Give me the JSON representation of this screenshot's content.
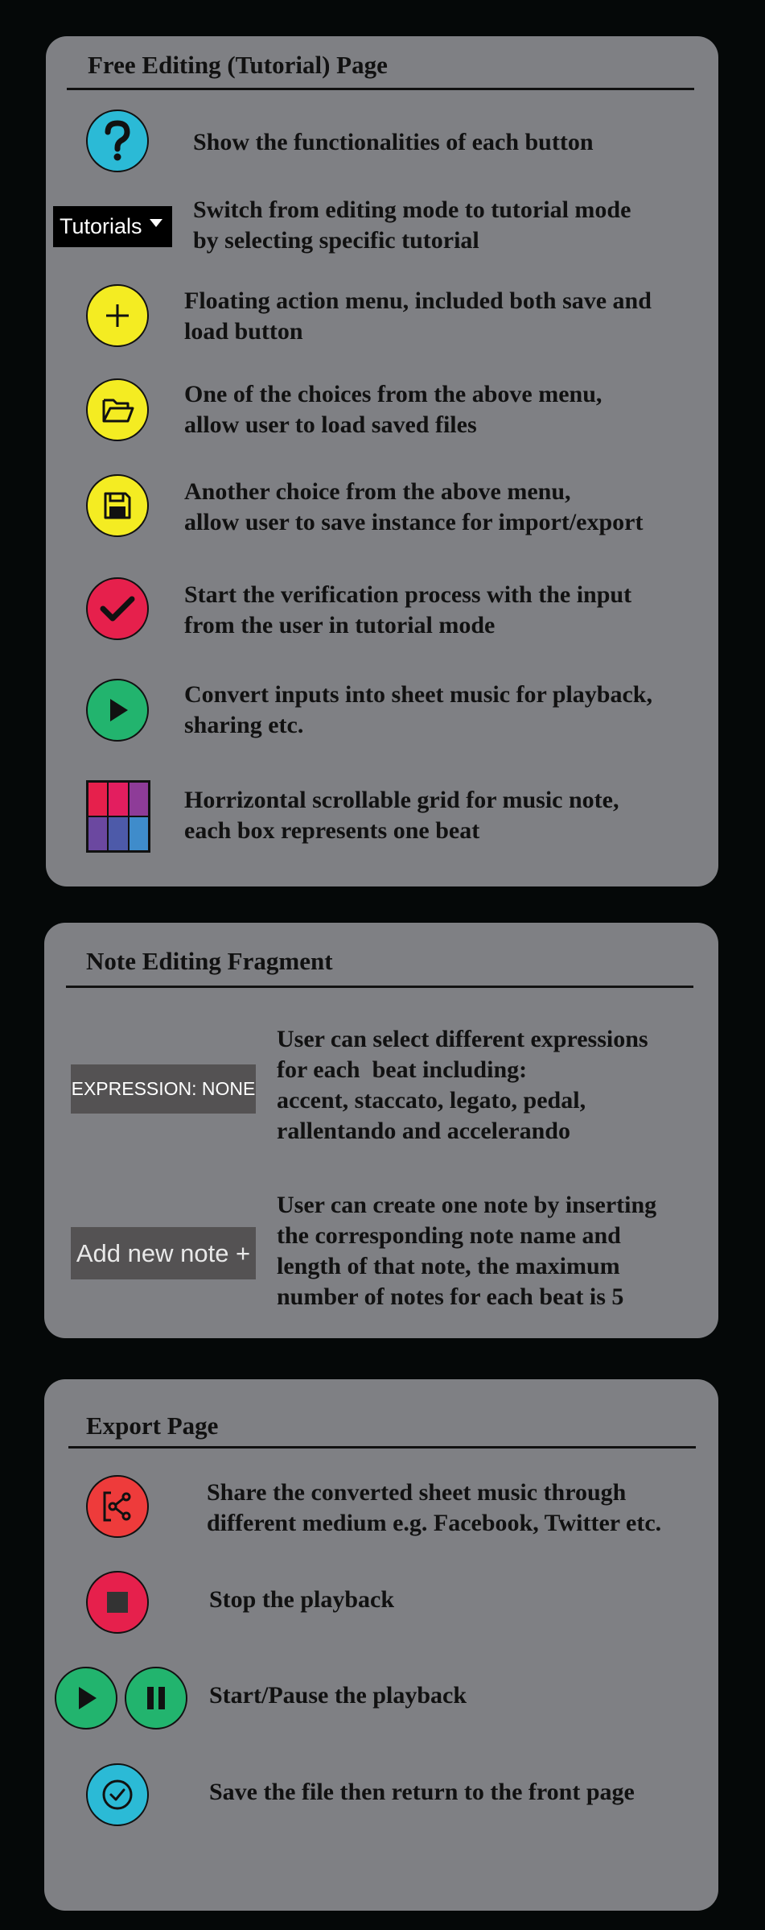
{
  "tutorial_panel": {
    "title": "Free Editing (Tutorial) Page",
    "rows": [
      {
        "icon": "question-icon",
        "color": "#2bbad6",
        "desc": "Show the functionalities of each button"
      },
      {
        "icon": "dropdown",
        "label": "Tutorials",
        "desc": "Switch from editing mode to tutorial mode\nby selecting specific tutorial"
      },
      {
        "icon": "plus-icon",
        "color": "#f4ec22",
        "desc": "Floating action menu, included both save and\nload button"
      },
      {
        "icon": "folder-open-icon",
        "color": "#f4ec22",
        "desc": "One of the choices from the above menu,\nallow user to load saved files"
      },
      {
        "icon": "floppy-disk-icon",
        "color": "#f4ec22",
        "desc": "Another choice from the above menu,\nallow user to save instance for import/export"
      },
      {
        "icon": "checkmark-icon",
        "color": "#e6204c",
        "desc": "Start the verification process with the input\nfrom the user in tutorial mode"
      },
      {
        "icon": "play-icon",
        "color": "#22b46e",
        "desc": "Convert inputs into sheet music for playback,\nsharing etc."
      },
      {
        "icon": "beat-grid-icon",
        "grid_colors": [
          "#e6204c",
          "#e31e5f",
          "#8e3c98",
          "#6b48a0",
          "#4d5aa9",
          "#3f8ccb"
        ],
        "desc": "Horrizontal scrollable grid for music note,\neach box represents one beat"
      }
    ]
  },
  "note_panel": {
    "title": "Note Editing Fragment",
    "expression_button": "EXPRESSION: NONE",
    "expression_desc": "User can select different expressions\nfor each  beat including:\naccent, staccato, legato, pedal,\nrallentando and accelerando",
    "add_note_button": "Add new note +",
    "add_note_desc": "User can create one note by inserting\nthe corresponding note name and\nlength of that note, the maximum\nnumber of notes for each beat is 5"
  },
  "export_panel": {
    "title": "Export Page",
    "rows": [
      {
        "icon": "share-icon",
        "color": "#ee3b3b",
        "desc": "Share the converted sheet music through\ndifferent medium e.g. Facebook, Twitter etc."
      },
      {
        "icon": "stop-icon",
        "color": "#e6204c",
        "desc": "Stop the playback"
      },
      {
        "icon": "play-pause-icons",
        "color": "#22b46e",
        "desc": "Start/Pause the playback"
      },
      {
        "icon": "check-circle-icon",
        "color": "#2bbad6",
        "desc": "Save the file then return to the front page"
      }
    ]
  }
}
